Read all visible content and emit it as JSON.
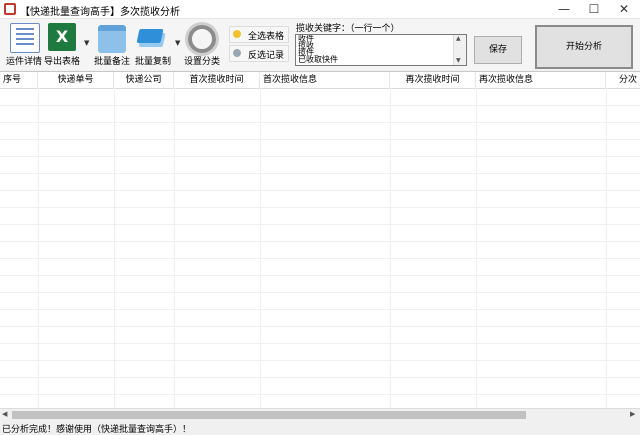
{
  "window": {
    "title": "【快递批量查询高手】多次揽收分析",
    "min_icon": "—",
    "max_icon": "☐",
    "close_icon": "✕"
  },
  "toolbar": {
    "tools": [
      {
        "label": "运件详情",
        "icon": "document-icon"
      },
      {
        "label": "导出表格",
        "icon": "excel-icon"
      },
      {
        "label": "批量备注",
        "icon": "folder-icon"
      },
      {
        "label": "批量复制",
        "icon": "copy-icon"
      },
      {
        "label": "设置分类",
        "icon": "gear-icon"
      }
    ],
    "dropdown_glyph": "▼",
    "select_all_label": "全选表格",
    "invert_label": "反选记录"
  },
  "keywords": {
    "label": "揽收关键字：（一行一个）",
    "text": "收件\n揽收\n揽件\n已收取快件",
    "scroll_up": "▲",
    "scroll_down": "▼"
  },
  "buttons": {
    "save": "保存",
    "start": "开始分析"
  },
  "table": {
    "columns": [
      "序号",
      "快递单号",
      "快递公司",
      "首次揽收时间",
      "首次揽收信息",
      "再次揽收时间",
      "再次揽收信息",
      "分次"
    ]
  },
  "scrollbar": {
    "left": "◀",
    "right": "▶"
  },
  "status": {
    "text": "已分析完成！感谢使用（快递批量查询高手）！"
  },
  "colors": {
    "excel": "#1f7a3f",
    "folder": "#8ec1ea",
    "copy": "#2f8fd8",
    "bulb": "#f2c12e"
  }
}
